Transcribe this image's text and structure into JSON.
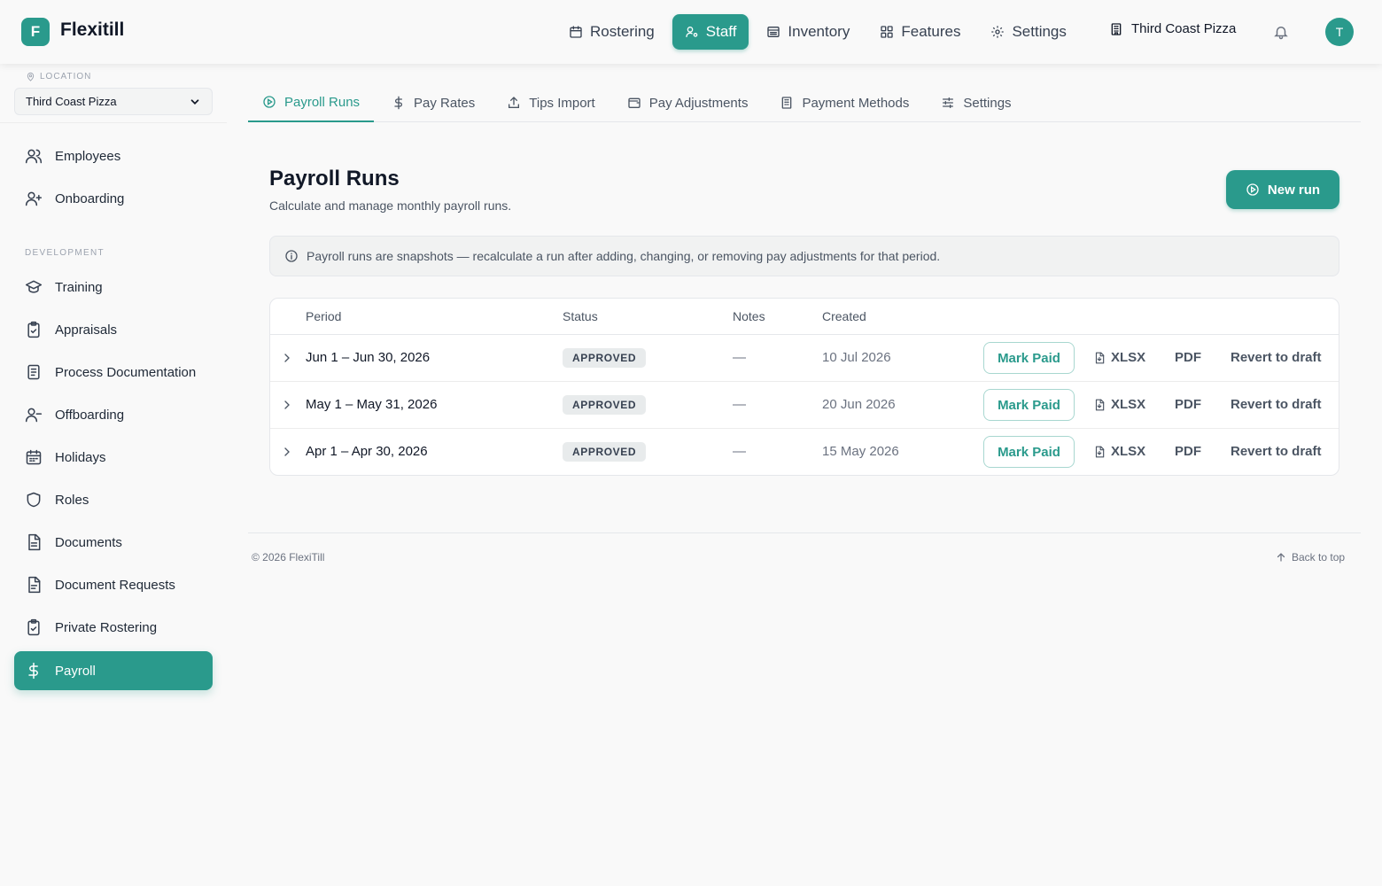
{
  "app": {
    "logo_letter": "F",
    "name": "Flexitill",
    "store": "Third Coast Pizza",
    "avatar_initial": "T"
  },
  "topnav": {
    "rostering": "Rostering",
    "staff": "Staff",
    "inventory": "Inventory",
    "features": "Features",
    "settings": "Settings"
  },
  "sidebar": {
    "location_label": "LOCATION",
    "location_value": "Third Coast Pizza",
    "section_development": "DEVELOPMENT",
    "items": {
      "employees": "Employees",
      "onboarding": "Onboarding",
      "training": "Training",
      "appraisals": "Appraisals",
      "process_documentation": "Process Documentation",
      "offboarding": "Offboarding",
      "holidays": "Holidays",
      "roles": "Roles",
      "documents": "Documents",
      "document_requests": "Document Requests",
      "private_rostering": "Private Rostering",
      "payroll": "Payroll"
    }
  },
  "tabs": {
    "payroll_runs": "Payroll Runs",
    "pay_rates": "Pay Rates",
    "tips_import": "Tips Import",
    "pay_adjustments": "Pay Adjustments",
    "payment_methods": "Payment Methods",
    "settings": "Settings"
  },
  "page": {
    "title": "Payroll Runs",
    "subtitle": "Calculate and manage monthly payroll runs.",
    "new_run": "New run",
    "info": "Payroll runs are snapshots — recalculate a run after adding, changing, or removing pay adjustments for that period."
  },
  "table": {
    "headers": {
      "period": "Period",
      "status": "Status",
      "notes": "Notes",
      "created": "Created"
    },
    "rows": [
      {
        "period": "Jun 1 – Jun 30, 2026",
        "status": "APPROVED",
        "notes": "—",
        "created": "10 Jul 2026",
        "mark_paid": "Mark Paid",
        "xlsx": "XLSX",
        "pdf": "PDF",
        "revert": "Revert to draft"
      },
      {
        "period": "May 1 – May 31, 2026",
        "status": "APPROVED",
        "notes": "—",
        "created": "20 Jun 2026",
        "mark_paid": "Mark Paid",
        "xlsx": "XLSX",
        "pdf": "PDF",
        "revert": "Revert to draft"
      },
      {
        "period": "Apr 1 – Apr 30, 2026",
        "status": "APPROVED",
        "notes": "—",
        "created": "15 May 2026",
        "mark_paid": "Mark Paid",
        "xlsx": "XLSX",
        "pdf": "PDF",
        "revert": "Revert to draft"
      }
    ]
  },
  "footer": {
    "copyright": "© 2026 FlexiTill",
    "back_to_top": "Back to top"
  },
  "colors": {
    "accent": "#2a9a8c",
    "background": "#f9f9f9"
  }
}
